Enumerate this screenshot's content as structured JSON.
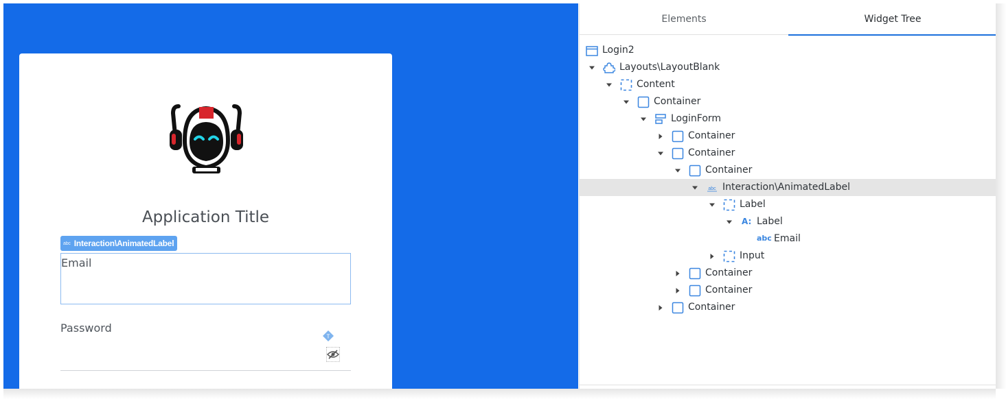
{
  "canvas": {
    "app_title": "Application Title",
    "selection_badge": {
      "icon": "abc",
      "label": "Interaction\\AnimatedLabel"
    },
    "email_label": "Email",
    "password_label": "Password",
    "marker_letter": "T"
  },
  "panel": {
    "tabs": [
      "Elements",
      "Widget Tree"
    ],
    "active_tab": "Widget Tree",
    "tree": [
      {
        "label": "Login2",
        "icon": "screen-icon"
      },
      {
        "label": "Layouts\\LayoutBlank",
        "icon": "block-icon",
        "expanded": true
      },
      {
        "label": "Content",
        "icon": "placeholder-icon",
        "expanded": true
      },
      {
        "label": "Container",
        "icon": "container-icon",
        "expanded": true
      },
      {
        "label": "LoginForm",
        "icon": "form-icon",
        "expanded": true
      },
      {
        "label": "Container",
        "icon": "container-icon",
        "expanded": false
      },
      {
        "label": "Container",
        "icon": "container-icon",
        "expanded": true
      },
      {
        "label": "Container",
        "icon": "container-icon",
        "expanded": true
      },
      {
        "label": "Interaction\\AnimatedLabel",
        "icon": "abc-small-icon",
        "expanded": true,
        "selected": true
      },
      {
        "label": "Label",
        "icon": "placeholder-icon",
        "expanded": true
      },
      {
        "label": "Label",
        "icon": "label-widget-icon",
        "icon_text": "A:",
        "expanded": true
      },
      {
        "label": "Email",
        "icon": "text-icon",
        "icon_text": "abc"
      },
      {
        "label": "Input",
        "icon": "placeholder-icon",
        "expanded": false
      },
      {
        "label": "Container",
        "icon": "container-icon",
        "expanded": false
      },
      {
        "label": "Container",
        "icon": "container-icon",
        "expanded": false
      },
      {
        "label": "Container",
        "icon": "container-icon",
        "expanded": false
      }
    ]
  },
  "colors": {
    "canvas_background": "#146be8",
    "accent": "#1a6fdc",
    "selection_badge": "#5ea3f0",
    "tree_icon": "#3a86e0",
    "logo_red": "#d8262c",
    "logo_cyan": "#22d3e6"
  }
}
